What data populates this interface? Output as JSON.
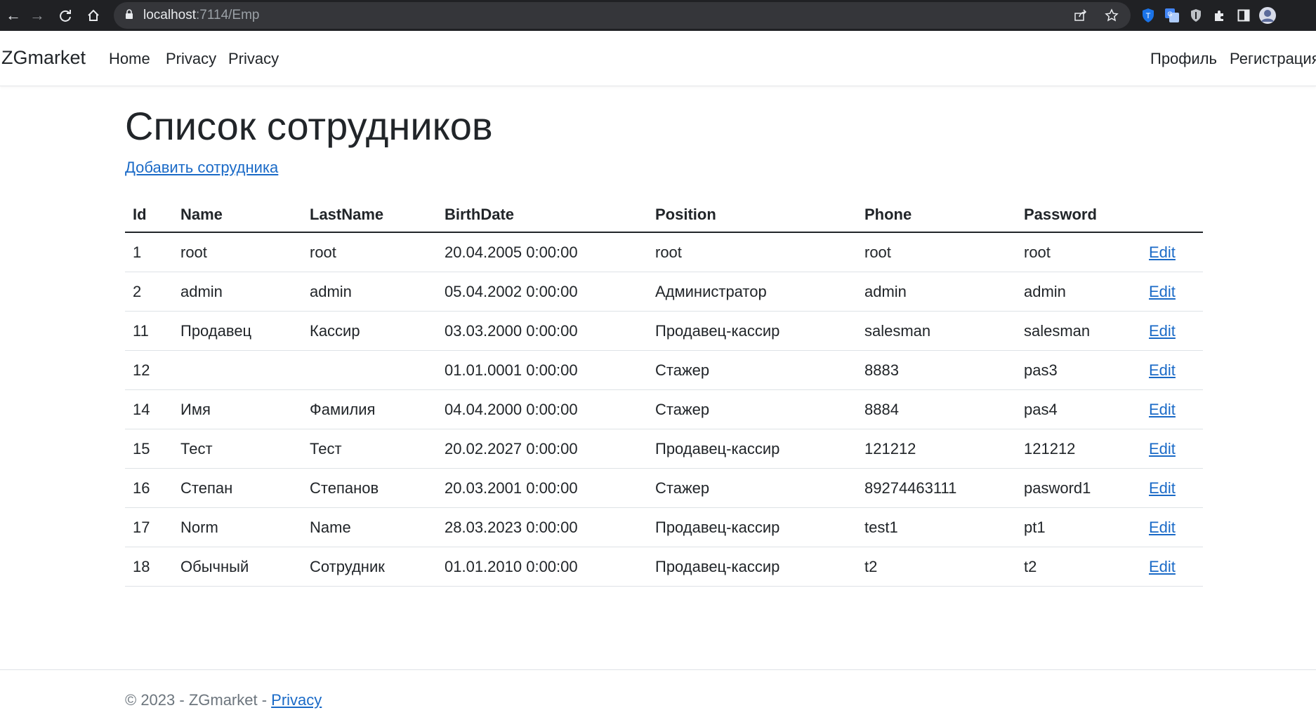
{
  "browser": {
    "url_host": "localhost",
    "url_path": ":7114/Emp"
  },
  "navbar": {
    "brand": "ZGmarket",
    "links": [
      "Home",
      "Privacy",
      "Privacy"
    ],
    "right_links": [
      "Профиль",
      "Регистрация"
    ]
  },
  "page": {
    "title": "Список сотрудников",
    "add_link": "Добавить сотрудника"
  },
  "table": {
    "headers": [
      "Id",
      "Name",
      "LastName",
      "BirthDate",
      "Position",
      "Phone",
      "Password"
    ],
    "edit_label": "Edit",
    "rows": [
      [
        "1",
        "root",
        "root",
        "20.04.2005 0:00:00",
        "root",
        "root",
        "root"
      ],
      [
        "2",
        "admin",
        "admin",
        "05.04.2002 0:00:00",
        "Администратор",
        "admin",
        "admin"
      ],
      [
        "11",
        "Продавец",
        "Кассир",
        "03.03.2000 0:00:00",
        "Продавец-кассир",
        "salesman",
        "salesman"
      ],
      [
        "12",
        "",
        "",
        "01.01.0001 0:00:00",
        "Стажер",
        "8883",
        "pas3"
      ],
      [
        "14",
        "Имя",
        "Фамилия",
        "04.04.2000 0:00:00",
        "Стажер",
        "8884",
        "pas4"
      ],
      [
        "15",
        "Тест",
        "Тест",
        "20.02.2027 0:00:00",
        "Продавец-кассир",
        "121212",
        "121212"
      ],
      [
        "16",
        "Степан",
        "Степанов",
        "20.03.2001 0:00:00",
        "Стажер",
        "89274463111",
        "pasword1"
      ],
      [
        "17",
        "Norm",
        "Name",
        "28.03.2023 0:00:00",
        "Продавец-кассир",
        "test1",
        "pt1"
      ],
      [
        "18",
        "Обычный",
        "Сотрудник",
        "01.01.2010 0:00:00",
        "Продавец-кассир",
        "t2",
        "t2"
      ]
    ]
  },
  "footer": {
    "text": "© 2023 - ZGmarket - ",
    "link": "Privacy"
  },
  "colors": {
    "link": "#1a6ac7",
    "chrome_bg": "#202124"
  }
}
